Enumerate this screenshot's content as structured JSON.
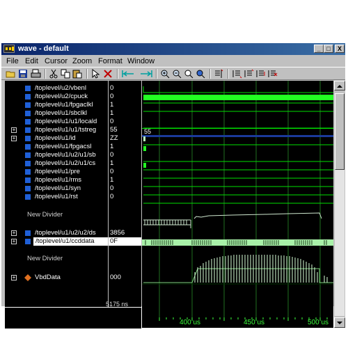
{
  "window": {
    "title": "wave - default"
  },
  "window_buttons": {
    "minimize": "_",
    "maximize": "□",
    "close": "X"
  },
  "menu": [
    "File",
    "Edit",
    "Cursor",
    "Zoom",
    "Format",
    "Window"
  ],
  "signals": [
    {
      "name": "/toplevel/u2/vbenl",
      "value": "0"
    },
    {
      "name": "/toplevel/u2/cpuck",
      "value": "0"
    },
    {
      "name": "/toplevel/u1/fpgaclkl",
      "value": "1"
    },
    {
      "name": "/toplevel/u1/sbclkl",
      "value": "1"
    },
    {
      "name": "/toplevel/u1/u1/locald",
      "value": "0"
    },
    {
      "name": "/toplevel/u1/u1/tstreg",
      "value": "55",
      "expand": "+"
    },
    {
      "name": "/toplevel/u1/id",
      "value": "ZZ",
      "expand": "+"
    },
    {
      "name": "/toplevel/u1/fpgacsl",
      "value": "1"
    },
    {
      "name": "/toplevel/u1/u2/u1/sb",
      "value": "0"
    },
    {
      "name": "/toplevel/u1/u2/u1/cs",
      "value": "1"
    },
    {
      "name": "/toplevel/u1/pre",
      "value": "0"
    },
    {
      "name": "/toplevel/u1/rms",
      "value": "1"
    },
    {
      "name": "/toplevel/u1/syn",
      "value": "0"
    },
    {
      "name": "/toplevel/u1/rst",
      "value": "0"
    }
  ],
  "divider1": "New Divider",
  "group1": [
    {
      "name": "/toplevel/u1/u2/u2/ds",
      "value": "3856",
      "expand": "+"
    },
    {
      "name": "/toplevel/u1/ccddata",
      "value": "0F",
      "expand": "+",
      "selected": true
    }
  ],
  "divider2": "New Divider",
  "analog": {
    "name": "VbdData",
    "value": "000",
    "expand": "+"
  },
  "wave_labels": {
    "tstreg": "55"
  },
  "cursor_time": "5175 ns",
  "timeline": [
    "400 us",
    "450 us",
    "500 us"
  ]
}
